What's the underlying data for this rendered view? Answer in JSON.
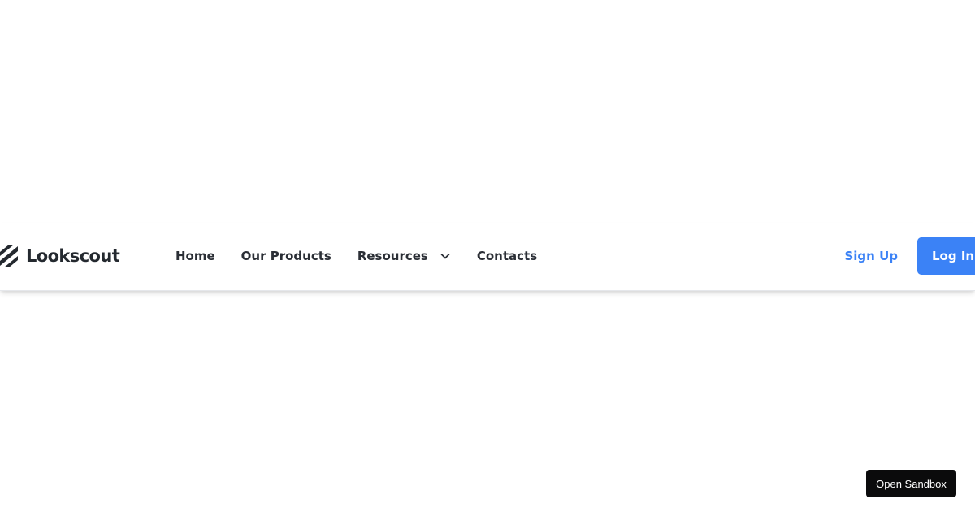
{
  "brand": {
    "name": "Lookscout",
    "icon": "lookscout-logo-icon"
  },
  "nav": {
    "items": [
      {
        "label": "Home"
      },
      {
        "label": "Our Products"
      },
      {
        "label": "Resources",
        "icon": "chevron-down-icon"
      },
      {
        "label": "Contacts"
      }
    ]
  },
  "auth": {
    "signup_label": "Sign Up",
    "login_label": "Log In"
  },
  "sandbox": {
    "label": "Open Sandbox"
  },
  "colors": {
    "accent": "#3b82f6",
    "text": "#2b2f36",
    "sandbox_bg": "#0b0b0c"
  }
}
